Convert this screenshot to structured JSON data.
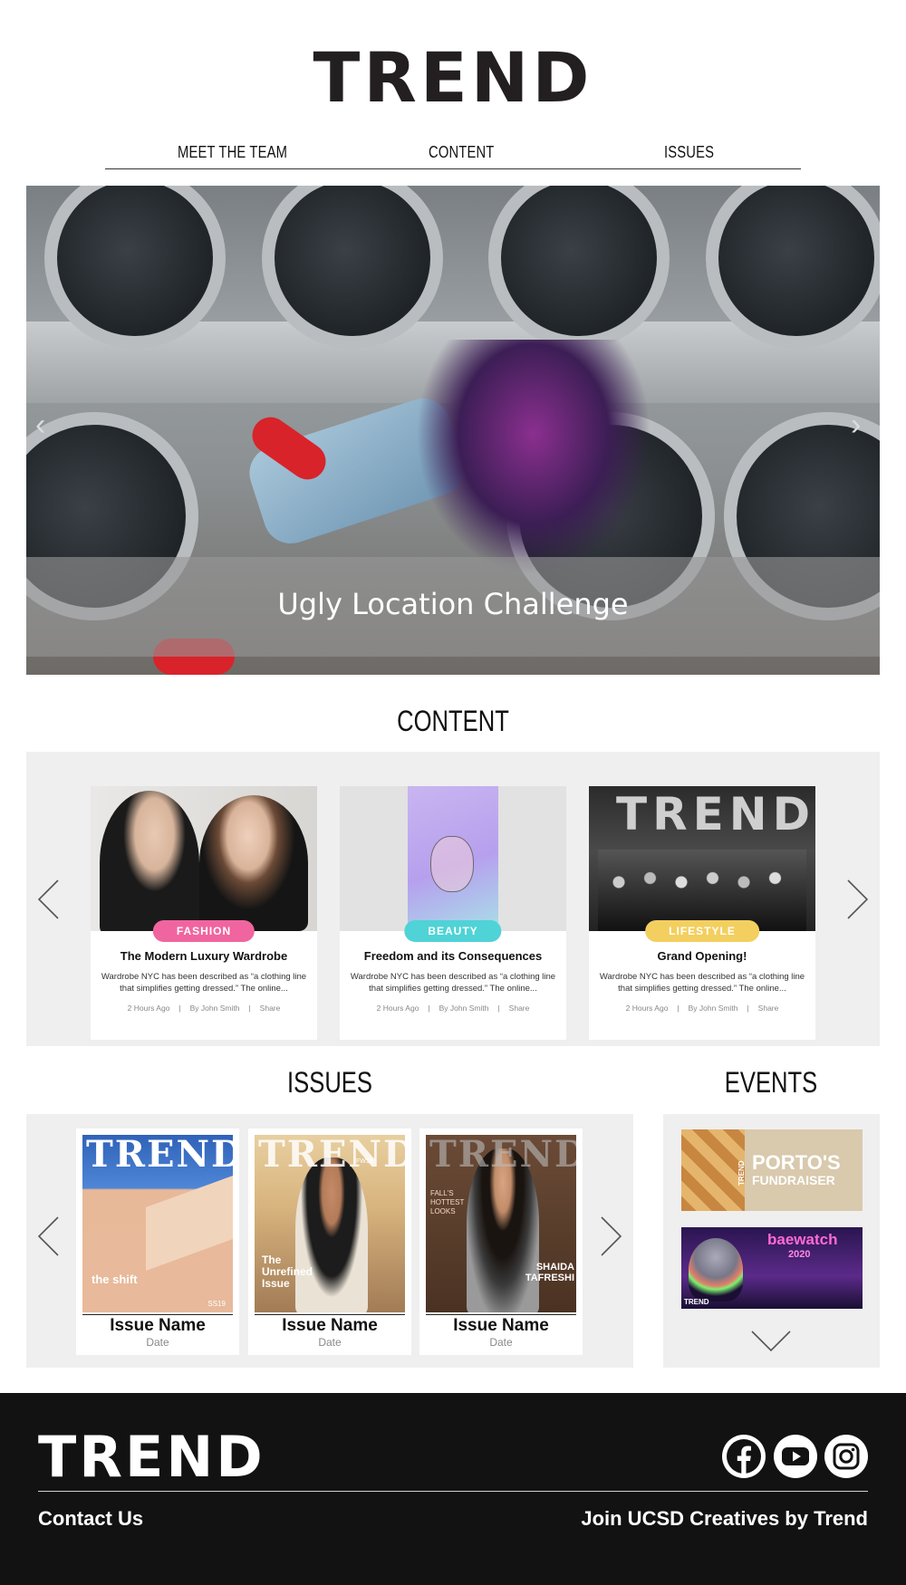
{
  "brand": "TREND",
  "nav": {
    "items": [
      "MEET THE TEAM",
      "CONTENT",
      "ISSUES"
    ]
  },
  "hero": {
    "caption": "Ugly Location Challenge"
  },
  "content": {
    "title": "CONTENT",
    "cards": [
      {
        "tag": "FASHION",
        "tag_color": "#f0659f",
        "title": "The Modern Luxury Wardrobe",
        "excerpt": "Wardrobe NYC has been described as “a clothing line that simplifies getting dressed.” The online...",
        "time": "2 Hours Ago",
        "author": "By John Smith",
        "share": "Share"
      },
      {
        "tag": "BEAUTY",
        "tag_color": "#4fd3d6",
        "title": "Freedom and its Consequences",
        "excerpt": "Wardrobe NYC has been described as “a clothing line that simplifies getting dressed.” The online...",
        "time": "2 Hours Ago",
        "author": "By John Smith",
        "share": "Share"
      },
      {
        "tag": "LIFESTYLE",
        "tag_color": "#f3cf5f",
        "title": "Grand Opening!",
        "excerpt": "Wardrobe NYC has been described as “a clothing line that simplifies getting dressed.” The online...",
        "time": "2 Hours Ago",
        "author": "By John Smith",
        "share": "Share"
      }
    ],
    "lifestyle_image_text": "TREND"
  },
  "issues": {
    "title": "ISSUES",
    "items": [
      {
        "masthead": "TREND",
        "cover_text": "the shift",
        "cover_code": "SS19",
        "name": "Issue Name",
        "date": "Date"
      },
      {
        "masthead": "TREND",
        "cover_text": "The Unrefined Issue",
        "cover_code": "FW18",
        "name": "Issue Name",
        "date": "Date"
      },
      {
        "masthead": "TREND",
        "cover_text": "SHAIDA TAFRESHI",
        "cover_code": "FALL'S HOTTEST LOOKS",
        "name": "Issue Name",
        "date": "Date"
      }
    ]
  },
  "events": {
    "title": "EVENTS",
    "items": [
      {
        "headline": "PORTO'S",
        "sub": "FUNDRAISER",
        "brand": "TREND"
      },
      {
        "headline": "baewatch",
        "sub": "2020",
        "brand": "TREND"
      }
    ]
  },
  "footer": {
    "logo": "TREND",
    "contact": "Contact Us",
    "join": "Join UCSD Creatives by Trend",
    "social": [
      "facebook-icon",
      "youtube-icon",
      "instagram-icon"
    ]
  }
}
